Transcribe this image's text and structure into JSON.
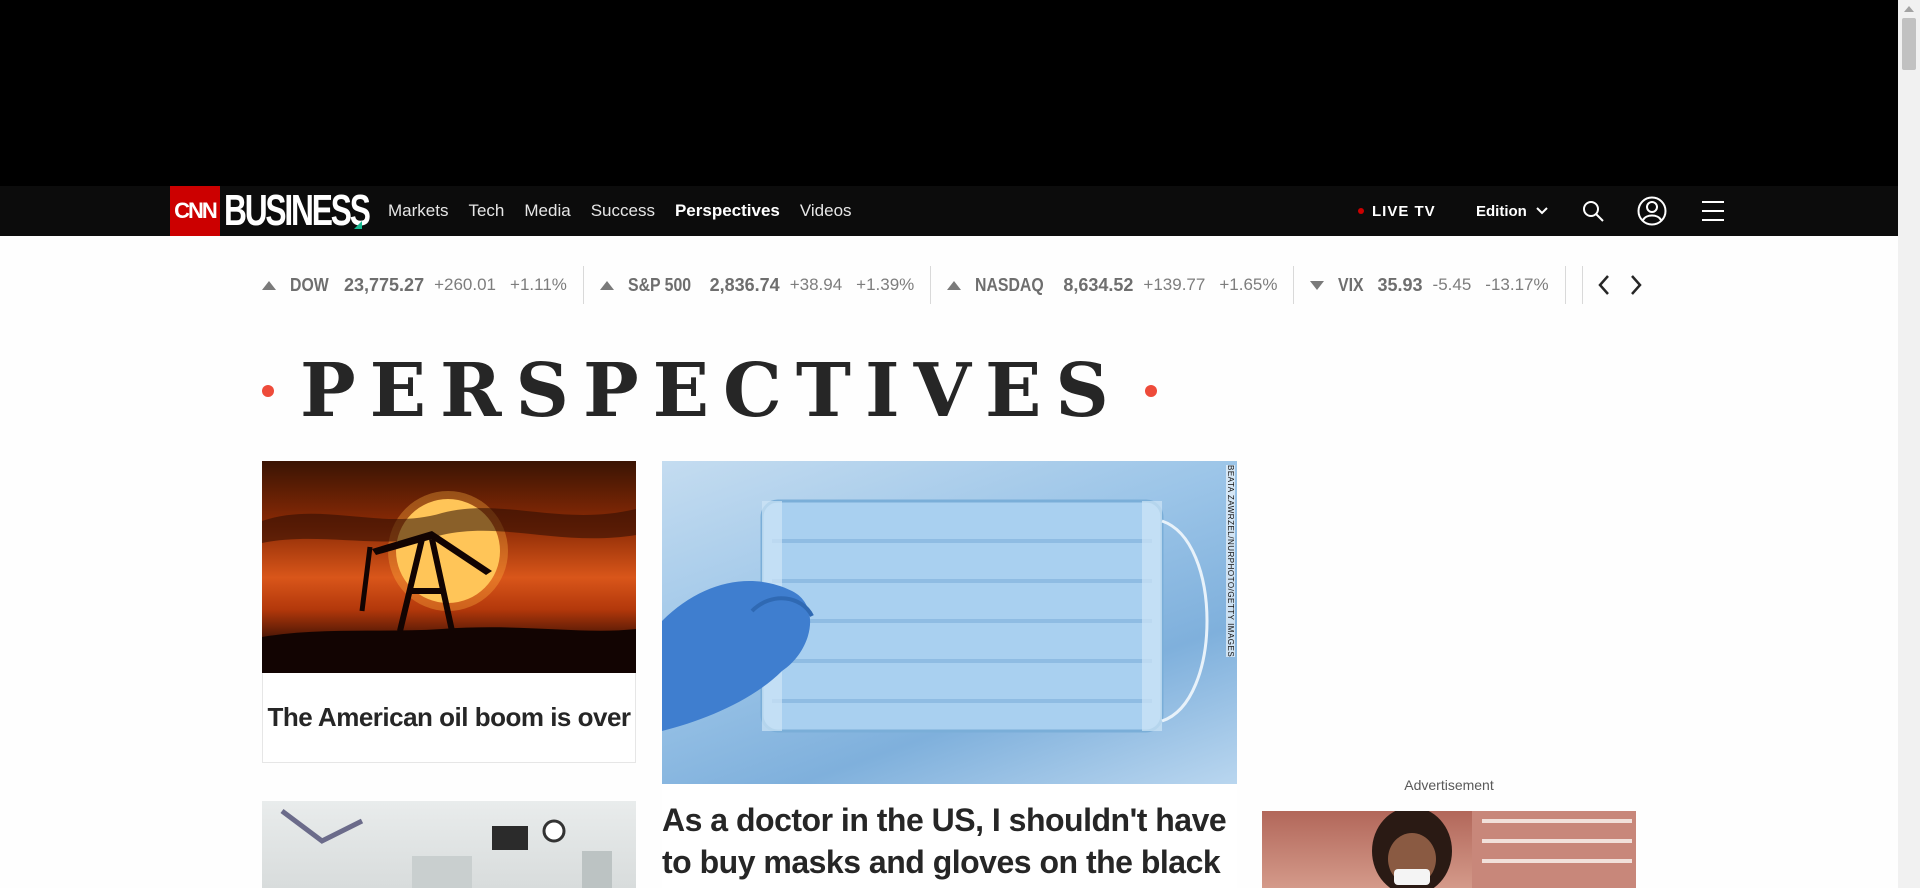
{
  "nav": {
    "logo_cnn": "CNN",
    "logo_business": "BUSINESS",
    "links": [
      "Markets",
      "Tech",
      "Media",
      "Success",
      "Perspectives",
      "Videos"
    ],
    "active_link": "Perspectives",
    "live_tv": "LIVE TV",
    "edition": "Edition",
    "icons": [
      "search-icon",
      "account-icon",
      "menu-icon"
    ]
  },
  "ticker": [
    {
      "name": "DOW",
      "value": "23,775.27",
      "change": "+260.01",
      "pct": "+1.11%",
      "direction": "up"
    },
    {
      "name": "S&P 500",
      "value": "2,836.74",
      "change": "+38.94",
      "pct": "+1.39%",
      "direction": "up"
    },
    {
      "name": "NASDAQ",
      "value": "8,634.52",
      "change": "+139.77",
      "pct": "+1.65%",
      "direction": "up"
    },
    {
      "name": "VIX",
      "value": "35.93",
      "change": "-5.45",
      "pct": "-13.17%",
      "direction": "down"
    }
  ],
  "section": {
    "title": "PERSPECTIVES",
    "accent_color": "#ee4b3a"
  },
  "cards": {
    "oil": {
      "headline": "The American oil boom is over"
    },
    "masks": {
      "headline": "As a doctor in the US, I shouldn't have to buy masks and gloves on the black",
      "photo_credit": "BEATA ZAWRZEL/NURPHOTO/GETTY IMAGES"
    }
  },
  "advertisement_label": "Advertisement",
  "colors": {
    "cnn_red": "#cc0000",
    "business_green": "#17b890",
    "navbar_bg": "#0c0c0c"
  }
}
